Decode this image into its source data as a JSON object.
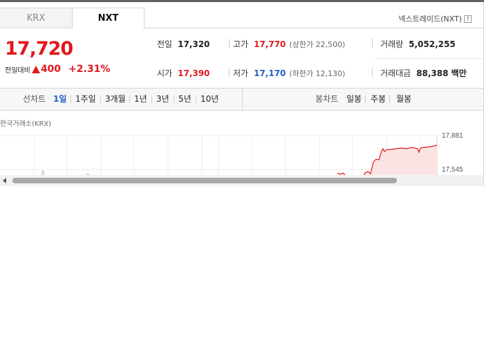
{
  "tabs": [
    {
      "label": "KRX",
      "active": false
    },
    {
      "label": "NXT",
      "active": true
    }
  ],
  "nxt_link": {
    "label": "넥스트레이드(NXT)",
    "icon": "help-icon",
    "icon_glyph": "?"
  },
  "price": {
    "current": "17,720",
    "change_label": "전일대비",
    "change_direction_icon": "up-triangle-icon",
    "change_value": "400",
    "change_pct": "+2.31%"
  },
  "stats": {
    "prev_close": {
      "label": "전일",
      "value": "17,320"
    },
    "open": {
      "label": "시가",
      "value": "17,390"
    },
    "high": {
      "label": "고가",
      "value": "17,770",
      "sub": "(상한가 22,500)"
    },
    "low": {
      "label": "저가",
      "value": "17,170",
      "sub": "(하한가 12,130)"
    },
    "volume": {
      "label": "거래량",
      "value": "5,052,255"
    },
    "amount": {
      "label": "거래대금",
      "value": "88,388 백만"
    }
  },
  "toolbar": {
    "line_label": "선차트",
    "line_periods": [
      "1일",
      "1주일",
      "3개월",
      "1년",
      "3년",
      "5년",
      "10년"
    ],
    "active_period": "1일",
    "candle_label": "봉차트",
    "candle_periods": [
      "일봉",
      "주봉",
      "월봉"
    ]
  },
  "chart": {
    "exchange_label": "한국거래소(KRX)",
    "y_ticks": [
      "17,881",
      "17,545"
    ],
    "line_color": "#e0181d",
    "fill_color": "#fbe3e3"
  },
  "colors": {
    "up": "#e0181d",
    "down": "#1f5fc7",
    "active": "#1f5fc7"
  }
}
